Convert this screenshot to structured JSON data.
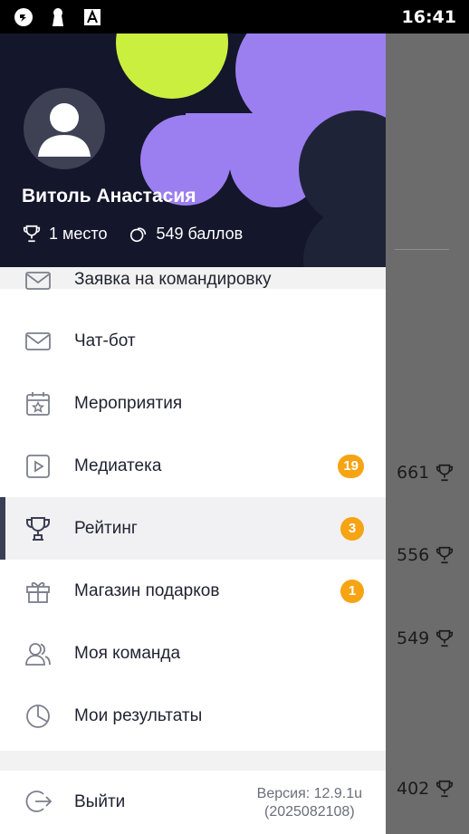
{
  "status_bar": {
    "time": "16:41",
    "icons": [
      "sync-icon",
      "keyhole-icon",
      "font-a-icon"
    ]
  },
  "profile": {
    "name": "Витоль Анастасия",
    "place": "1 место",
    "points": "549 баллов"
  },
  "menu": {
    "items": [
      {
        "label": "Заявка на командировку",
        "icon": "envelope-icon"
      },
      {
        "label": "Чат-бот",
        "icon": "envelope-icon"
      },
      {
        "label": "Мероприятия",
        "icon": "calendar-star-icon"
      },
      {
        "label": "Медиатека",
        "icon": "play-icon",
        "badge": "19"
      },
      {
        "label": "Рейтинг",
        "icon": "trophy-icon",
        "badge": "3",
        "active": true
      },
      {
        "label": "Магазин подарков",
        "icon": "gift-icon",
        "badge": "1"
      },
      {
        "label": "Моя команда",
        "icon": "people-icon"
      },
      {
        "label": "Мои результаты",
        "icon": "pie-chart-icon"
      }
    ]
  },
  "footer": {
    "logout_label": "Выйти",
    "version_line1": "Версия: 12.9.1u",
    "version_line2": "(2025082108)"
  },
  "background_list": {
    "scores": [
      "661",
      "556",
      "549",
      "402"
    ]
  },
  "colors": {
    "header_bg": "#14162b",
    "purple": "#9b7ff0",
    "lime": "#cbef3f",
    "badge": "#f6a314",
    "active_indicator": "#3b3f55"
  }
}
